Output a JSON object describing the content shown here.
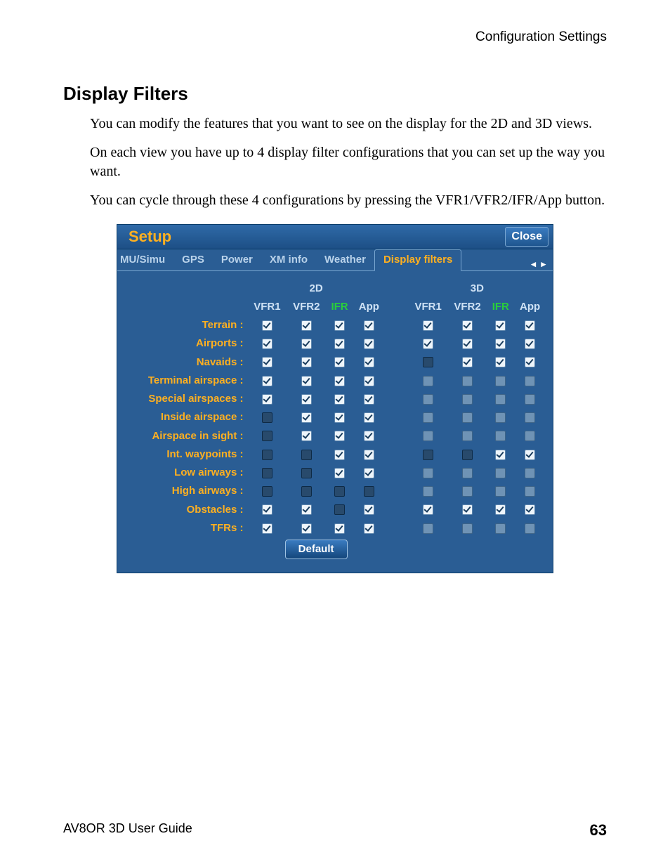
{
  "header": {
    "right": "Configuration Settings"
  },
  "section": {
    "title": "Display Filters"
  },
  "paragraphs": {
    "p1": "You can modify the features that you want to see on the display for the 2D and 3D views.",
    "p2": "On each view you have up to 4 display filter configurations that you can set up the way you want.",
    "p3": "You can cycle through these 4 configurations by pressing the VFR1/VFR2/IFR/App button."
  },
  "window": {
    "title": "Setup",
    "close": "Close",
    "tabs": {
      "t0": "MU/Simu",
      "t1": "GPS",
      "t2": "Power",
      "t3": "XM info",
      "t4": "Weather",
      "t5": "Display filters"
    },
    "arrows": "◂ ▸"
  },
  "headers": {
    "group2d": "2D",
    "group3d": "3D",
    "vfr1": "VFR1",
    "vfr2": "VFR2",
    "ifr": "IFR",
    "app": "App"
  },
  "rows": {
    "terrain": "Terrain :",
    "airports": "Airports :",
    "navaids": "Navaids :",
    "terminal": "Terminal airspace :",
    "special": "Special airspaces :",
    "inside": "Inside airspace :",
    "insight": "Airspace in sight :",
    "intwp": "Int. waypoints :",
    "lowair": "Low airways :",
    "highair": "High airways :",
    "obstacles": "Obstacles :",
    "tfrs": "TFRs :"
  },
  "buttons": {
    "default": "Default"
  },
  "footer": {
    "left": "AV8OR 3D User Guide",
    "page": "63"
  },
  "grid": {
    "terrain": {
      "d2": [
        "c",
        "c",
        "c",
        "c"
      ],
      "d3": [
        "c",
        "c",
        "c",
        "c"
      ]
    },
    "airports": {
      "d2": [
        "c",
        "c",
        "c",
        "c"
      ],
      "d3": [
        "c",
        "c",
        "c",
        "c"
      ]
    },
    "navaids": {
      "d2": [
        "c",
        "c",
        "c",
        "c"
      ],
      "d3": [
        "u",
        "c",
        "c",
        "c"
      ]
    },
    "terminal": {
      "d2": [
        "c",
        "c",
        "c",
        "c"
      ],
      "d3": [
        "d",
        "d",
        "d",
        "d"
      ]
    },
    "special": {
      "d2": [
        "c",
        "c",
        "c",
        "c"
      ],
      "d3": [
        "d",
        "d",
        "d",
        "d"
      ]
    },
    "inside": {
      "d2": [
        "u",
        "c",
        "c",
        "c"
      ],
      "d3": [
        "d",
        "d",
        "d",
        "d"
      ]
    },
    "insight": {
      "d2": [
        "u",
        "c",
        "c",
        "c"
      ],
      "d3": [
        "d",
        "d",
        "d",
        "d"
      ]
    },
    "intwp": {
      "d2": [
        "u",
        "u",
        "c",
        "c"
      ],
      "d3": [
        "u",
        "u",
        "c",
        "c"
      ]
    },
    "lowair": {
      "d2": [
        "u",
        "u",
        "c",
        "c"
      ],
      "d3": [
        "d",
        "d",
        "d",
        "d"
      ]
    },
    "highair": {
      "d2": [
        "u",
        "u",
        "u",
        "u"
      ],
      "d3": [
        "d",
        "d",
        "d",
        "d"
      ]
    },
    "obstacles": {
      "d2": [
        "c",
        "c",
        "u",
        "c"
      ],
      "d3": [
        "c",
        "c",
        "c",
        "c"
      ]
    },
    "tfrs": {
      "d2": [
        "c",
        "c",
        "c",
        "c"
      ],
      "d3": [
        "d",
        "d",
        "d",
        "d"
      ]
    }
  }
}
